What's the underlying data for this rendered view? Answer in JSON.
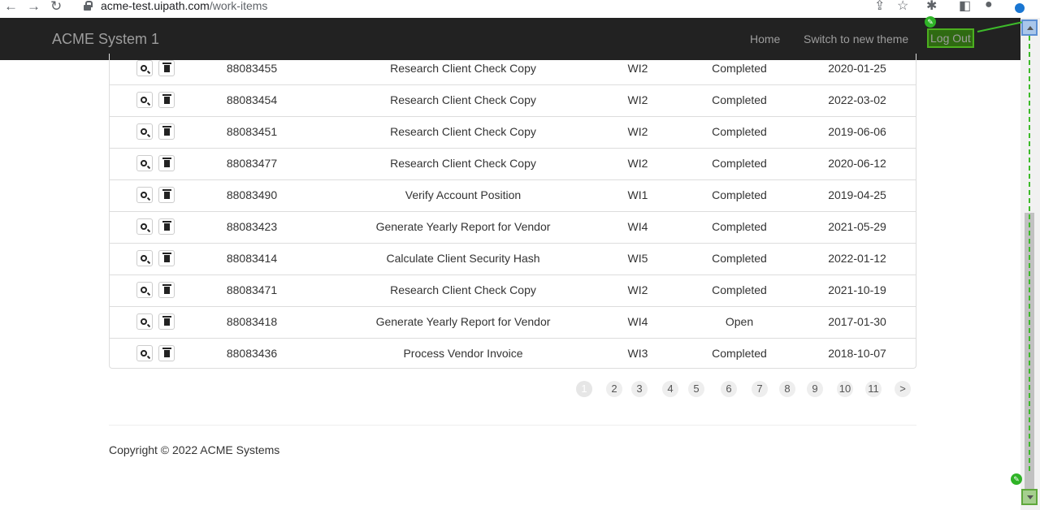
{
  "browser": {
    "url_host": "acme-test.uipath.com",
    "url_path": "/work-items"
  },
  "navbar": {
    "brand": "ACME System 1",
    "links": {
      "home": "Home",
      "theme": "Switch to new theme",
      "logout": "Log Out"
    }
  },
  "table": {
    "rows": [
      {
        "id": "88083455",
        "description": "Research Client Check Copy",
        "type": "WI2",
        "status": "Completed",
        "date": "2020-01-25"
      },
      {
        "id": "88083454",
        "description": "Research Client Check Copy",
        "type": "WI2",
        "status": "Completed",
        "date": "2022-03-02"
      },
      {
        "id": "88083451",
        "description": "Research Client Check Copy",
        "type": "WI2",
        "status": "Completed",
        "date": "2019-06-06"
      },
      {
        "id": "88083477",
        "description": "Research Client Check Copy",
        "type": "WI2",
        "status": "Completed",
        "date": "2020-06-12"
      },
      {
        "id": "88083490",
        "description": "Verify Account Position",
        "type": "WI1",
        "status": "Completed",
        "date": "2019-04-25"
      },
      {
        "id": "88083423",
        "description": "Generate Yearly Report for Vendor",
        "type": "WI4",
        "status": "Completed",
        "date": "2021-05-29"
      },
      {
        "id": "88083414",
        "description": "Calculate Client Security Hash",
        "type": "WI5",
        "status": "Completed",
        "date": "2022-01-12"
      },
      {
        "id": "88083471",
        "description": "Research Client Check Copy",
        "type": "WI2",
        "status": "Completed",
        "date": "2021-10-19"
      },
      {
        "id": "88083418",
        "description": "Generate Yearly Report for Vendor",
        "type": "WI4",
        "status": "Open",
        "date": "2017-01-30"
      },
      {
        "id": "88083436",
        "description": "Process Vendor Invoice",
        "type": "WI3",
        "status": "Completed",
        "date": "2018-10-07"
      }
    ]
  },
  "pagination": {
    "pages": [
      "1",
      "2",
      "3",
      "4",
      "5",
      "6",
      "7",
      "8",
      "9",
      "10",
      "11",
      ">"
    ],
    "current": "1"
  },
  "footer": {
    "copyright": "Copyright © 2022 ACME Systems"
  },
  "icons": {
    "view": "search-icon",
    "delete": "trash-icon"
  },
  "colors": {
    "navbar_bg": "#222222",
    "logout_highlight": "#2f6a12",
    "marker_green": "#3dbb2a"
  }
}
